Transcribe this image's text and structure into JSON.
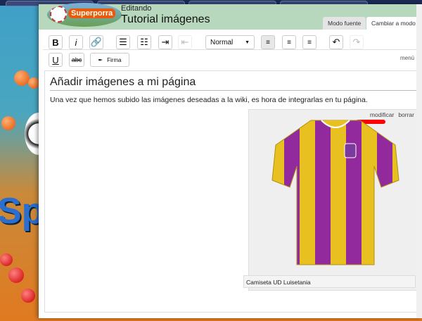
{
  "header": {
    "logo_text": "Superporra",
    "editing": "Editando",
    "title": "Tutorial imágenes"
  },
  "mode_tabs": [
    {
      "label": "Modo fuente"
    },
    {
      "label": "Cambiar a modo visual"
    }
  ],
  "toolbar": {
    "format_select": "Normal",
    "signature_label": "Firma",
    "more_label": "menú"
  },
  "content": {
    "heading": "Añadir imágenes a mi página",
    "paragraph": "Una vez que hemos subido las imágenes deseadas a la wiki, es hora de integrarlas en tu página.",
    "figure": {
      "edit_link": "modificar",
      "delete_link": "borrar",
      "caption": "Camiseta UD Luisetania"
    }
  },
  "wallpaper_text": "Sp"
}
